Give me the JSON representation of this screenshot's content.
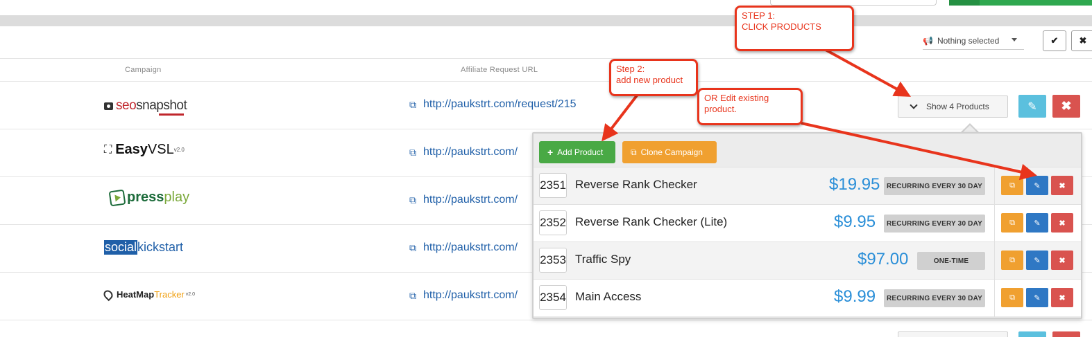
{
  "filter": {
    "selected_text": "Nothing selected",
    "confirm_glyph": "✔",
    "clear_glyph": "✖"
  },
  "table": {
    "columns": [
      "Campaign",
      "Affiliate Request URL"
    ],
    "rows": [
      {
        "logo": "seosnapshot",
        "url": "http://paukstrt.com/request/215"
      },
      {
        "logo": "EasyVSL",
        "url": "http://paukstrt.com/"
      },
      {
        "logo": "pressplay",
        "url": "http://paukstrt.com/"
      },
      {
        "logo": "socialkickstart",
        "url": "http://paukstrt.com/"
      },
      {
        "logo": "HeatMapTracker",
        "url": "http://paukstrt.com/"
      }
    ]
  },
  "logos": {
    "seo_part1": "seo",
    "seo_part2": "snapshot",
    "easy_part1": "Easy",
    "easy_part2": "VSL",
    "easy_version": "v2.0",
    "press_part1": "press",
    "press_part2": "play",
    "social_part1": "social",
    "social_part2": "kickstart",
    "heat_part1": "HeatMap",
    "heat_part2": "Tracker",
    "heat_version": "v2.0"
  },
  "show_products_label": "Show 4 Products",
  "popover": {
    "add_label": "Add Product",
    "clone_label": "Clone Campaign",
    "products": [
      {
        "id": "2351",
        "name": "Reverse Rank Checker",
        "price": "$19.95",
        "billing": "RECURRING EVERY 30 DAY"
      },
      {
        "id": "2352",
        "name": "Reverse Rank Checker (Lite)",
        "price": "$9.95",
        "billing": "RECURRING EVERY 30 DAY"
      },
      {
        "id": "2353",
        "name": "Traffic Spy",
        "price": "$97.00",
        "billing": "ONE-TIME"
      },
      {
        "id": "2354",
        "name": "Main Access",
        "price": "$9.99",
        "billing": "RECURRING EVERY 30 DAY"
      }
    ]
  },
  "annotations": {
    "step1": "STEP 1:\nCLICK PRODUCTS",
    "step2": "Step 2:\nadd new product",
    "or_edit": "OR Edit existing\nproduct."
  },
  "icons": {
    "link": "link-icon",
    "megaphone": "megaphone-icon",
    "chevron": "chevron-down-icon",
    "pencil": "pencil-icon",
    "close": "close-icon",
    "plus": "plus-icon",
    "copy": "copy-icon"
  },
  "colors": {
    "accent_blue": "#2b8fd8",
    "link_blue": "#1f5fa8",
    "success_green": "#49a945",
    "warning_orange": "#f0a030",
    "danger_red": "#d9534f",
    "info_blue": "#5bc0de",
    "annotation_red": "#e8341c"
  }
}
